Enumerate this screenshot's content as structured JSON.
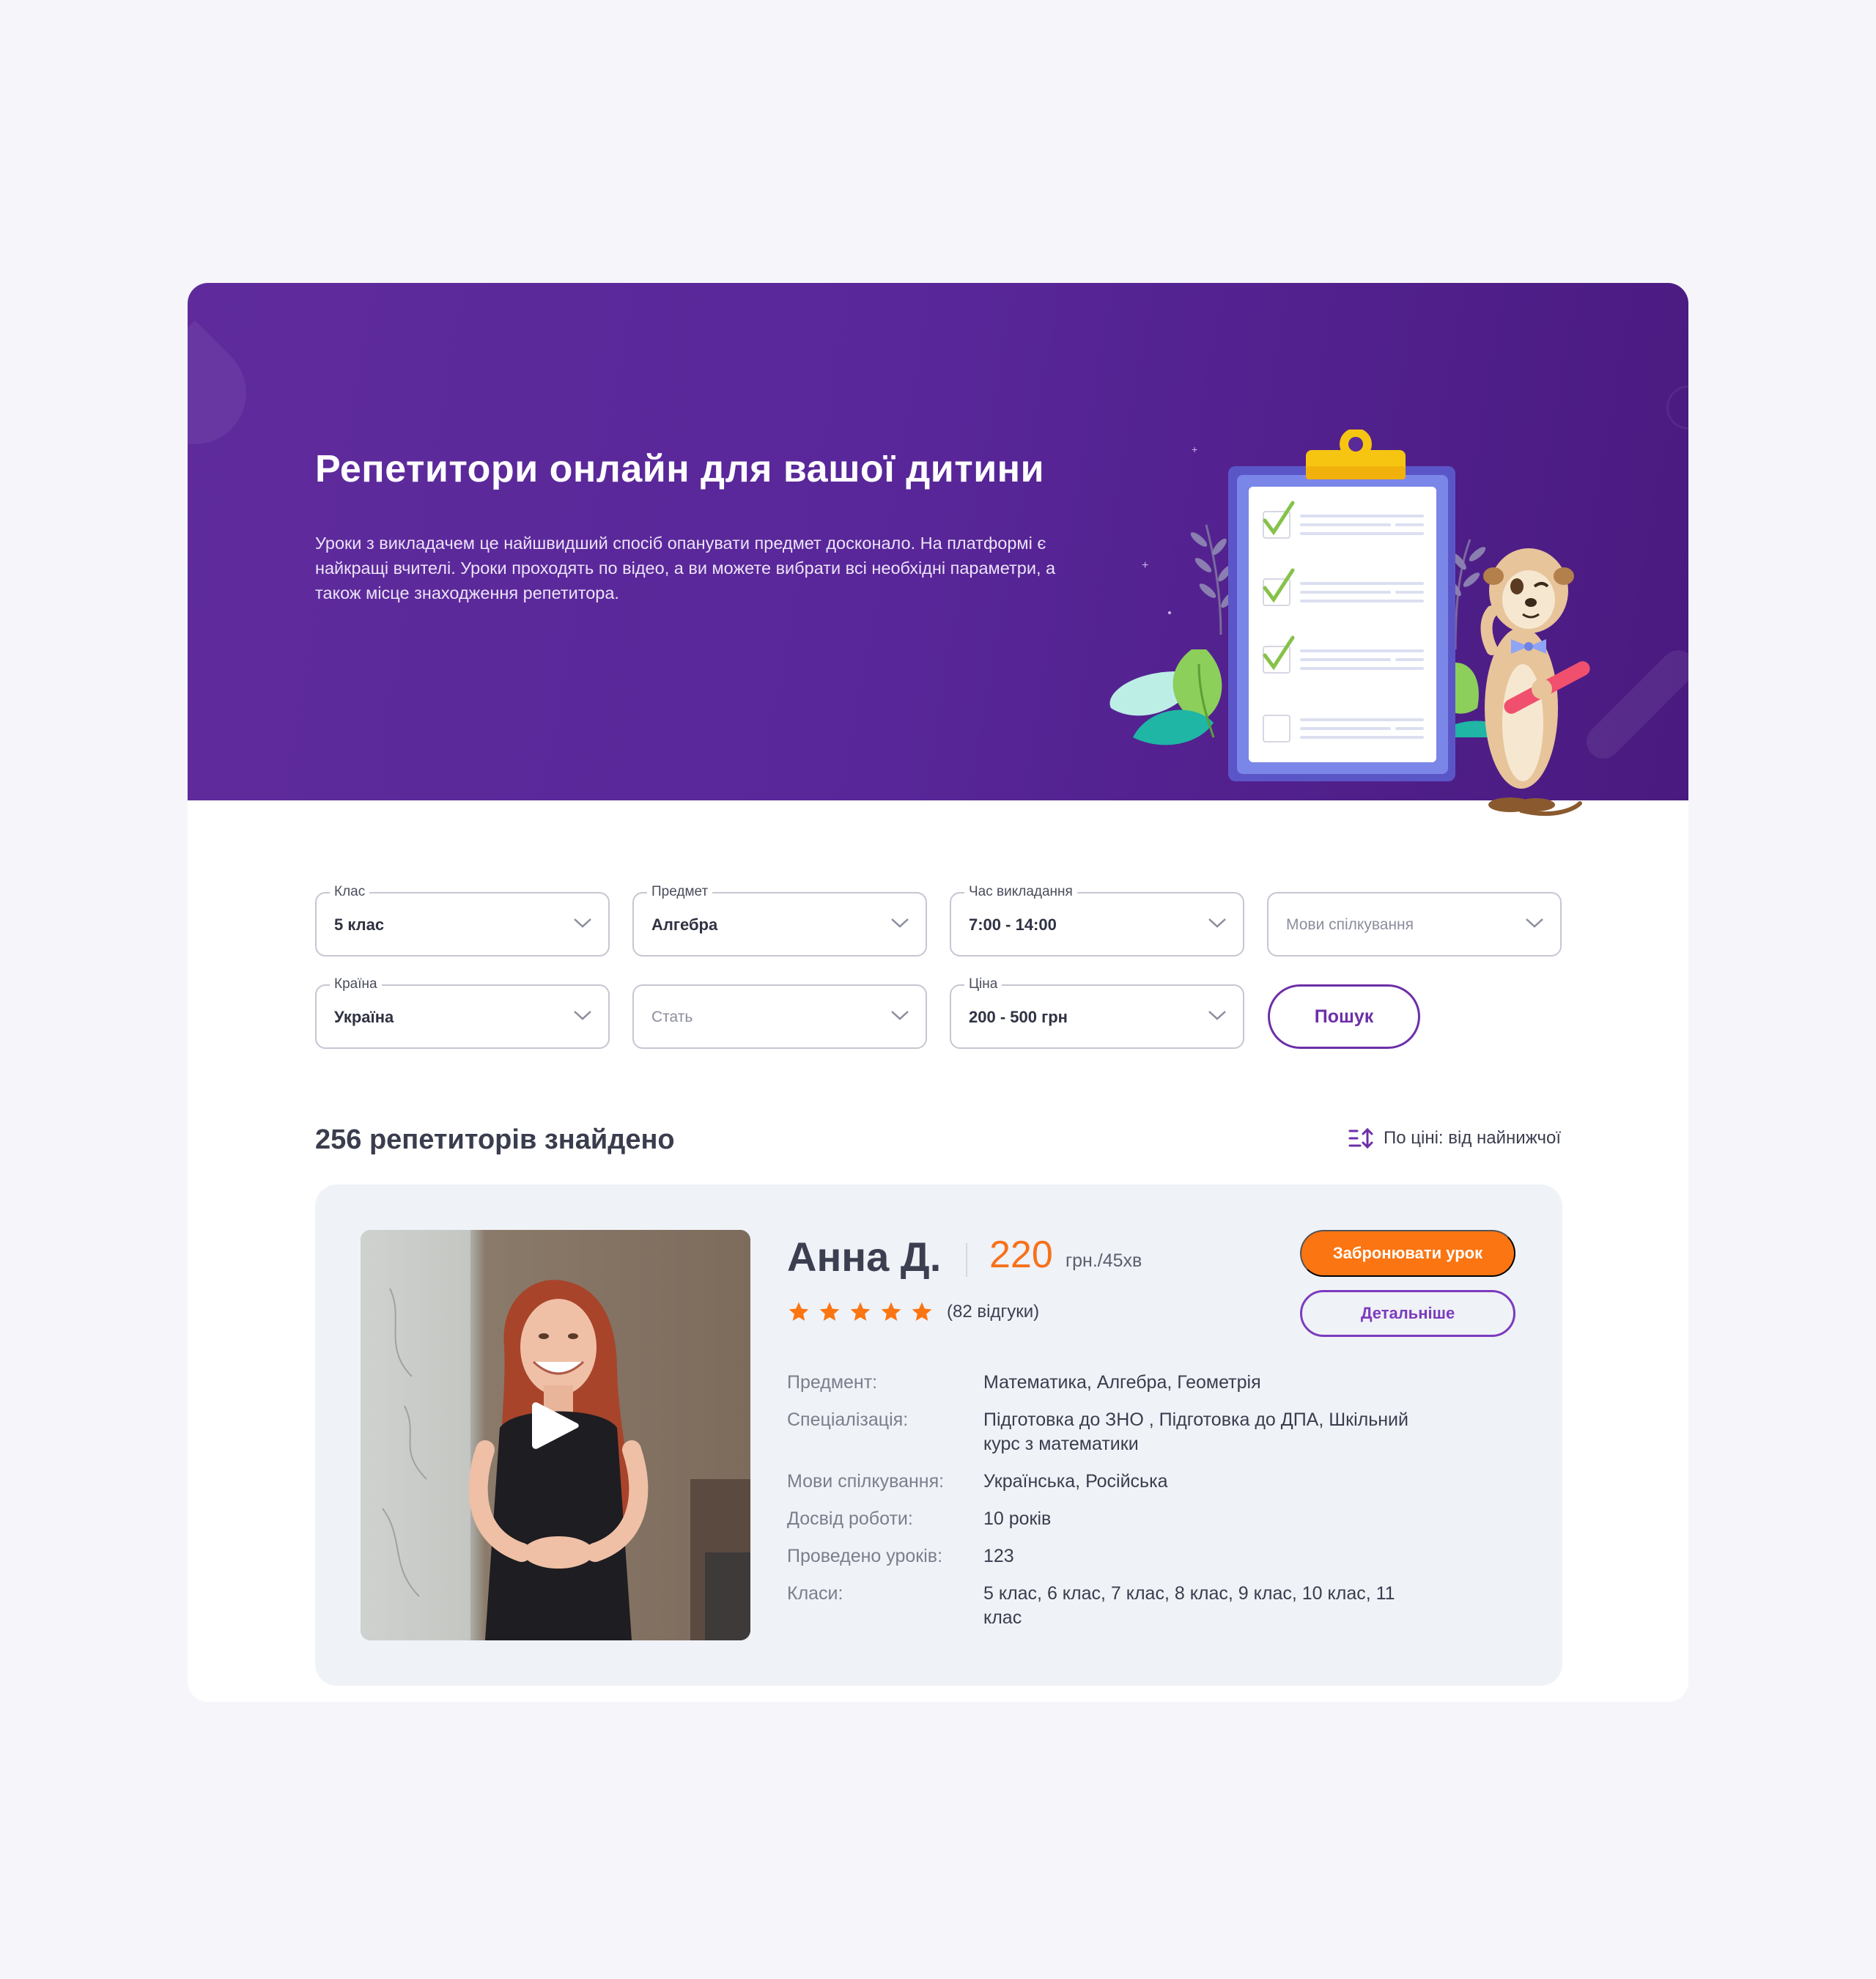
{
  "hero": {
    "title": "Репетитори онлайн для вашої дитини",
    "text": "Уроки з викладачем це найшвидший спосіб опанувати предмет досконало. На платформі є найкращі вчителі. Уроки проходять по відео, а ви можете вибрати всі необхідні параметри, а також місце знаходження репетитора."
  },
  "filters": {
    "grade": {
      "label": "Клас",
      "value": "5 клас"
    },
    "subject": {
      "label": "Предмет",
      "value": "Алгебра"
    },
    "time": {
      "label": "Час викладання",
      "value": "7:00 - 14:00"
    },
    "languages": {
      "placeholder": "Мови спілкування"
    },
    "country": {
      "label": "Країна",
      "value": "Україна"
    },
    "gender": {
      "placeholder": "Стать"
    },
    "price": {
      "label": "Ціна",
      "value": "200 - 500 грн"
    },
    "search_label": "Пошук"
  },
  "results": {
    "count_text": "256 репетиторів знайдено",
    "sort_label": "По ціні: від найнижчої"
  },
  "tutor": {
    "name": "Анна Д.",
    "price": "220",
    "price_unit": "грн./45хв",
    "rating": 5,
    "reviews": "(82 відгуки)",
    "book_label": "Забронювати урок",
    "details_label": "Детальніше",
    "info": [
      {
        "key": "Предмент:",
        "value": "Математика, Алгебра, Геометрія"
      },
      {
        "key": "Спеціалізація:",
        "value": "Підготовка до ЗНО , Підготовка до ДПА, Шкільний курс з математики"
      },
      {
        "key": "Мови спілкування:",
        "value": "Українська, Російська"
      },
      {
        "key": "Досвід роботи:",
        "value": "10 років"
      },
      {
        "key": "Проведено уроків:",
        "value": "123"
      },
      {
        "key": "Класи:",
        "value": "5 клас, 6 клас, 7 клас, 8 клас, 9 клас, 10 клас, 11 клас"
      }
    ]
  },
  "colors": {
    "hero_purple": "#5f2b9c",
    "accent_purple": "#6d2fa8",
    "accent_orange": "#fb7512",
    "card_bg": "#eff2f7"
  },
  "icons": {
    "dropdown": "chevron-down-icon",
    "sort": "sort-icon",
    "play": "play-icon",
    "star": "star-icon"
  }
}
